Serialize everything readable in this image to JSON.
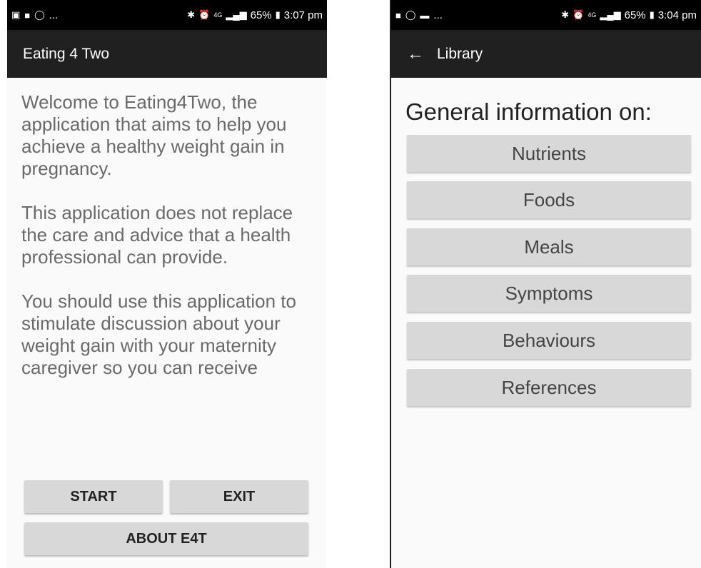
{
  "left_screen": {
    "status_bar": {
      "left_icons": [
        "gallery-icon",
        "facebook-icon",
        "whatsapp-icon"
      ],
      "left_more": "...",
      "right_icons": [
        "bluetooth-icon",
        "alarm-icon"
      ],
      "network": "4G",
      "battery": "65%",
      "time": "3:07 pm"
    },
    "app_bar": {
      "title": "Eating 4 Two"
    },
    "paragraphs": [
      "Welcome to Eating4Two, the application that aims to help you achieve a healthy weight gain in pregnancy.",
      "This application does not replace the care and advice that a health professional can provide.",
      "You should use this application to stimulate discussion about your weight gain with your maternity caregiver so you can receive"
    ],
    "buttons": {
      "start": "START",
      "exit": "EXIT",
      "about": "ABOUT E4T"
    }
  },
  "right_screen": {
    "status_bar": {
      "left_icons": [
        "facebook-icon",
        "whatsapp-icon",
        "message-icon"
      ],
      "left_more": "...",
      "right_icons": [
        "bluetooth-icon",
        "alarm-icon"
      ],
      "network": "4G",
      "battery": "65%",
      "time": "3:04 pm"
    },
    "app_bar": {
      "back_icon": "arrow-back-icon",
      "title": "Library"
    },
    "heading": "General information on:",
    "items": [
      "Nutrients",
      "Foods",
      "Meals",
      "Symptoms",
      "Behaviours",
      "References"
    ]
  }
}
